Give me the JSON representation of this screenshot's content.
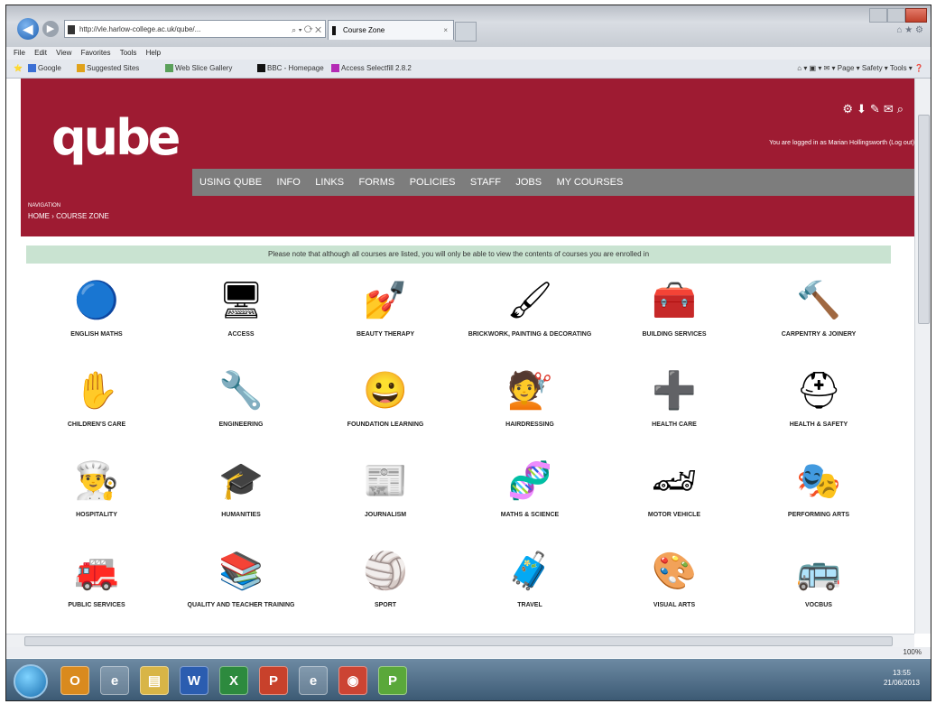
{
  "browser": {
    "address": "http://vle.harlow-college.ac.uk/qube/...",
    "tab_title": "Course Zone",
    "menu": [
      "File",
      "Edit",
      "View",
      "Favorites",
      "Tools",
      "Help"
    ],
    "favorites": [
      "Google",
      "Suggested Sites",
      "Web Slice Gallery",
      "BBC - Homepage",
      "Access Selectfill 2.8.2"
    ],
    "command_bar": "Page ▾  Safety ▾  Tools ▾",
    "zoom": "100%"
  },
  "site": {
    "logo": "qube",
    "login_text": "You are logged in as Marian Hollingsworth (Log out)",
    "nav": [
      "USING QUBE",
      "INFO",
      "LINKS",
      "FORMS",
      "POLICIES",
      "STAFF",
      "JOBS",
      "MY COURSES"
    ],
    "crumb_label": "NAVIGATION",
    "crumb": "HOME › COURSE ZONE",
    "notice": "Please note that although all courses are listed, you will only be able to view the contents of courses you are enrolled in"
  },
  "courses": [
    {
      "label": "English Maths",
      "icon": "english-maths-icon",
      "glyph": "🔵"
    },
    {
      "label": "Access",
      "icon": "computer-icon",
      "glyph": "🖥"
    },
    {
      "label": "Beauty Therapy",
      "icon": "nail-polish-icon",
      "glyph": "💅"
    },
    {
      "label": "Brickwork, Painting & Decorating",
      "icon": "paint-brush-icon",
      "glyph": "🖌"
    },
    {
      "label": "Building Services",
      "icon": "toolbox-icon",
      "glyph": "🧰"
    },
    {
      "label": "Carpentry & Joinery",
      "icon": "tools-icon",
      "glyph": "🔨"
    },
    {
      "label": "Children's Care",
      "icon": "handprints-icon",
      "glyph": "✋"
    },
    {
      "label": "Engineering",
      "icon": "engineering-tools-icon",
      "glyph": "🔧"
    },
    {
      "label": "Foundation Learning",
      "icon": "smiley-icon",
      "glyph": "😀"
    },
    {
      "label": "Hairdressing",
      "icon": "hair-icon",
      "glyph": "💇"
    },
    {
      "label": "Health Care",
      "icon": "plus-icon",
      "glyph": "➕"
    },
    {
      "label": "Health & Safety",
      "icon": "hard-hat-icon",
      "glyph": "⛑"
    },
    {
      "label": "Hospitality",
      "icon": "chef-hat-icon",
      "glyph": "👨‍🍳"
    },
    {
      "label": "Humanities",
      "icon": "graduate-icon",
      "glyph": "🎓"
    },
    {
      "label": "Journalism",
      "icon": "newspaper-icon",
      "glyph": "📰"
    },
    {
      "label": "Maths & Science",
      "icon": "dna-icon",
      "glyph": "🧬"
    },
    {
      "label": "Motor Vehicle",
      "icon": "car-icon",
      "glyph": "🏎"
    },
    {
      "label": "Performing Arts",
      "icon": "theatre-masks-icon",
      "glyph": "🎭"
    },
    {
      "label": "Public Services",
      "icon": "public-services-icon",
      "glyph": "🚒"
    },
    {
      "label": "Quality and Teacher Training",
      "icon": "books-icon",
      "glyph": "📚"
    },
    {
      "label": "Sport",
      "icon": "volleyball-icon",
      "glyph": "🏐"
    },
    {
      "label": "Travel",
      "icon": "suitcase-icon",
      "glyph": "🧳"
    },
    {
      "label": "Visual Arts",
      "icon": "painting-icon",
      "glyph": "🎨"
    },
    {
      "label": "VocBus",
      "icon": "vocbus-icon",
      "glyph": "🚌"
    }
  ],
  "taskbar": {
    "time": "13:55",
    "date": "21/06/2013"
  }
}
